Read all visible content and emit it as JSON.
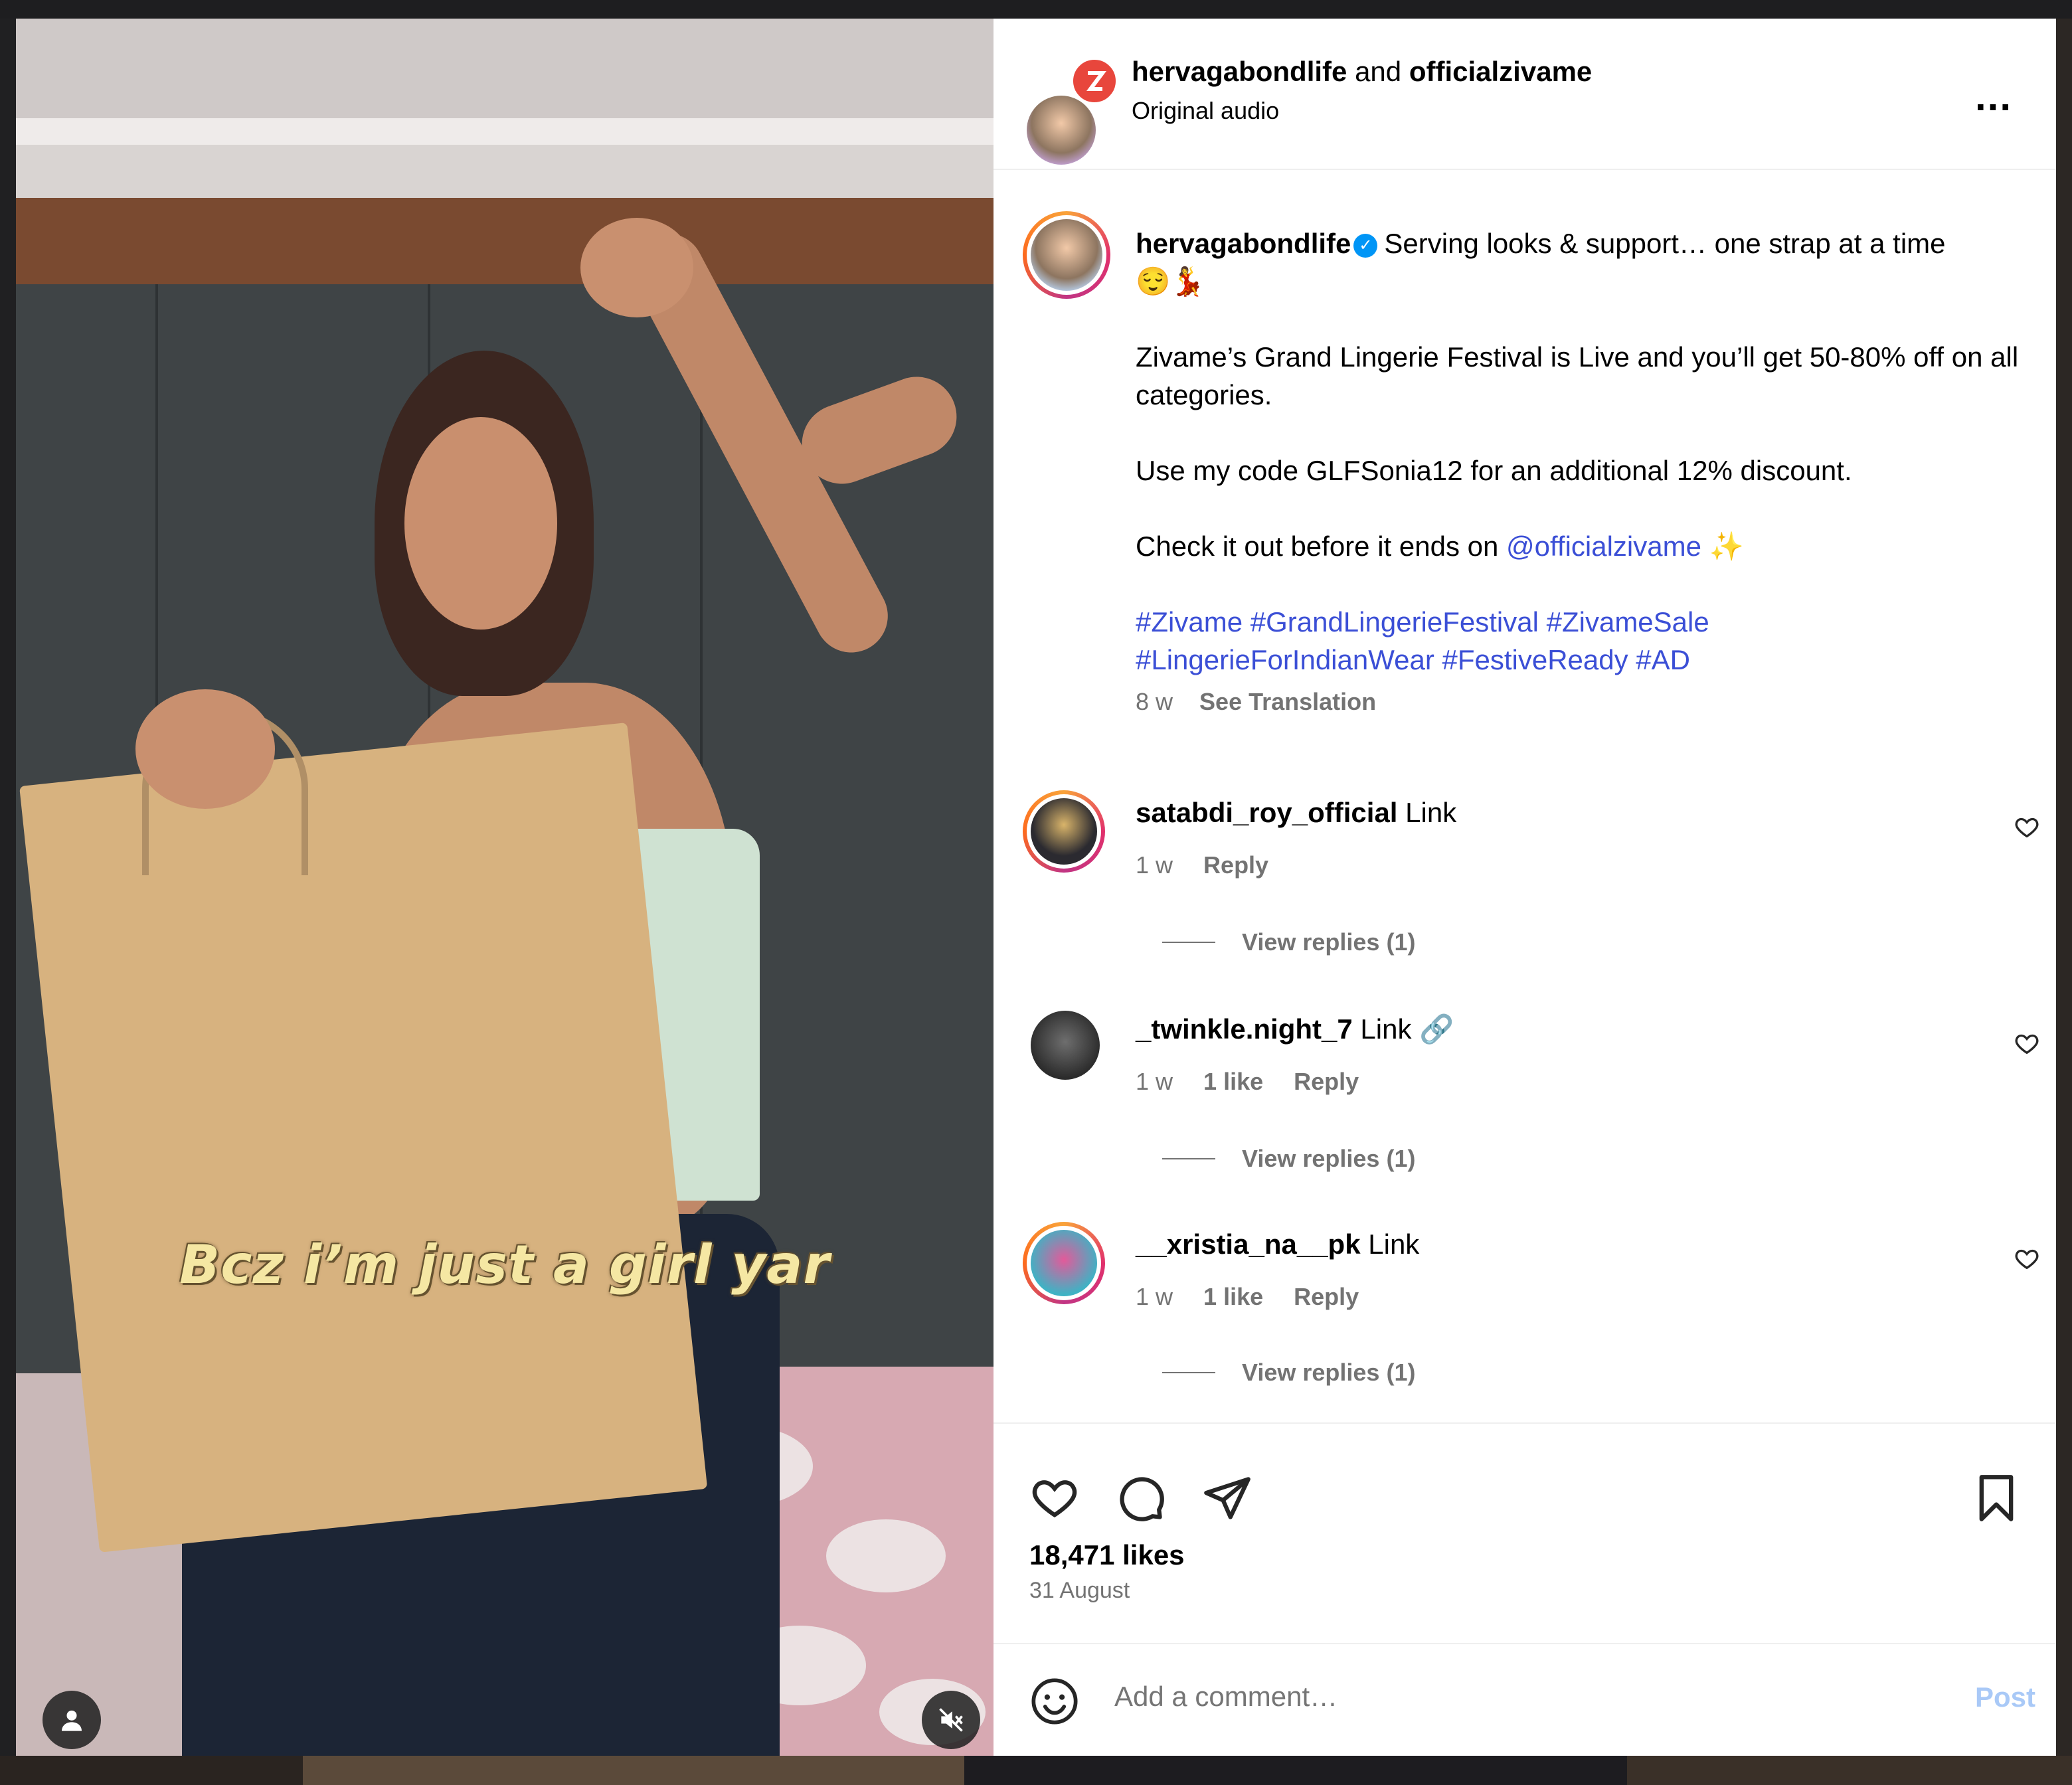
{
  "media": {
    "caption_overlay": "Bcz i’m just a girl yar"
  },
  "header": {
    "author": "hervagabondlife",
    "joiner": "and",
    "coauthor": "officialzivame",
    "audio": "Original audio",
    "more_label": "..."
  },
  "post": {
    "username": "hervagabondlife",
    "caption_line1": "Serving looks & support… one strap at a time",
    "caption_emoji": "😌💃",
    "para1": "Zivame’s Grand Lingerie Festival is Live and you’ll get 50-80% off on all categories.",
    "para2": "Use my code GLFSonia12 for an additional 12% discount.",
    "para3_prefix": "Check it out before it ends on",
    "para3_mention": "@officialzivame",
    "para3_emoji": "✨",
    "hashtags_line1": "#Zivame #GrandLingerieFestival #ZivameSale",
    "hashtags_line2": "#LingerieForIndianWear #FestiveReady #AD",
    "age": "8 w",
    "see_translation": "See Translation"
  },
  "comments": [
    {
      "username": "satabdi_roy_official",
      "text": "Link",
      "extra": "",
      "age": "1 w",
      "likes": "",
      "reply": "Reply",
      "view_replies": "View replies (1)"
    },
    {
      "username": "_twinkle.night_7",
      "text": "Link",
      "extra": "🔗",
      "age": "1 w",
      "likes": "1 like",
      "reply": "Reply",
      "view_replies": "View replies (1)"
    },
    {
      "username": "__xristia_na__pk",
      "text": "Link",
      "extra": "",
      "age": "1 w",
      "likes": "1 like",
      "reply": "Reply",
      "view_replies": "View replies (1)"
    }
  ],
  "actions": {
    "likes": "18,471 likes",
    "date": "31 August"
  },
  "composer": {
    "placeholder": "Add a comment…",
    "post_label": "Post"
  },
  "icons": [
    "heart-icon",
    "comment-icon",
    "share-icon",
    "bookmark-icon",
    "emoji-icon",
    "more-icon",
    "user-tag-icon",
    "mute-icon",
    "verified-icon"
  ],
  "colors": {
    "link": "#3b4fd6",
    "muted": "#737373",
    "verified": "#0095f6",
    "post_disabled": "#a9c9f7"
  }
}
